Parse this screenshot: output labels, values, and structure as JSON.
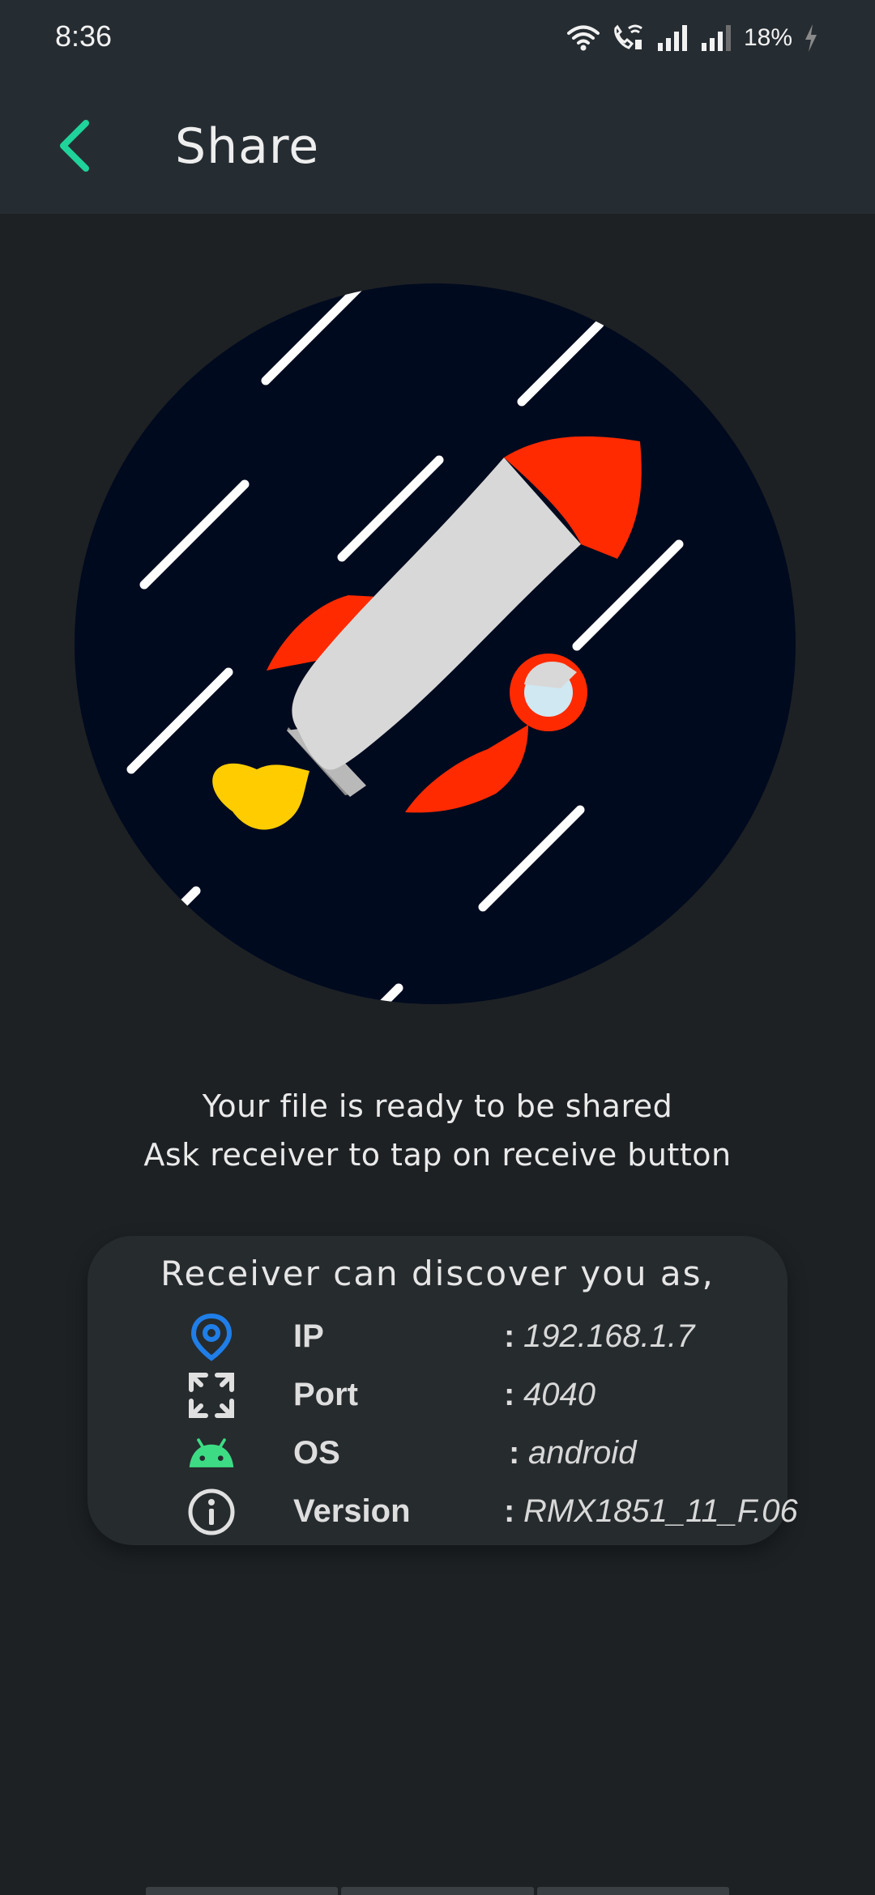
{
  "status_bar": {
    "time": "8:36",
    "battery": "18%",
    "icons": [
      "wifi-icon",
      "wifi-call-icon",
      "signal-icon",
      "signal-weak-icon",
      "charging-icon"
    ]
  },
  "app_bar": {
    "title": "Share",
    "back_icon": "chevron-left-icon",
    "accent_color": "#1fd39a"
  },
  "hero": {
    "icon": "rocket-illustration",
    "background_color": "#000a1e"
  },
  "message": {
    "line1": "Your file is ready to be shared",
    "line2": "Ask receiver to tap on receive button"
  },
  "card": {
    "heading": "Receiver can discover you as,",
    "rows": [
      {
        "icon": "location-pin-icon",
        "key": "IP",
        "sep": ":",
        "value": "192.168.1.7"
      },
      {
        "icon": "port-arrows-icon",
        "key": "Port",
        "sep": ":",
        "value": "4040"
      },
      {
        "icon": "android-icon",
        "key": "OS",
        "sep": ":",
        "value": "android"
      },
      {
        "icon": "info-icon",
        "key": "Version",
        "sep": ":",
        "value": "RMX1851_11_F.06"
      }
    ]
  }
}
